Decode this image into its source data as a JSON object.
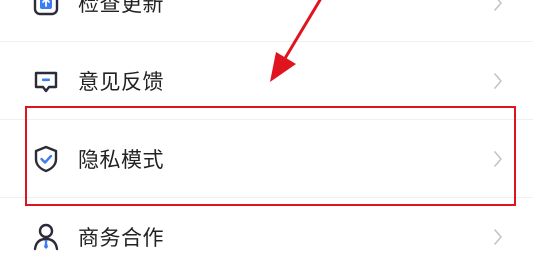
{
  "settings": {
    "items": [
      {
        "label": "检查更新",
        "icon": "update-icon"
      },
      {
        "label": "意见反馈",
        "icon": "feedback-icon"
      },
      {
        "label": "隐私模式",
        "icon": "privacy-shield-icon"
      },
      {
        "label": "商务合作",
        "icon": "business-person-icon"
      }
    ],
    "chevron_icon": "chevron-right-icon"
  },
  "annotation": {
    "highlight_color": "#e0141e",
    "arrow_color": "#e0141e",
    "highlighted_item": "隐私模式"
  },
  "colors": {
    "icon_dark": "#2b2b3a",
    "icon_accent": "#3d7cf5",
    "chevron": "#c4c4c4",
    "text": "#222222"
  }
}
